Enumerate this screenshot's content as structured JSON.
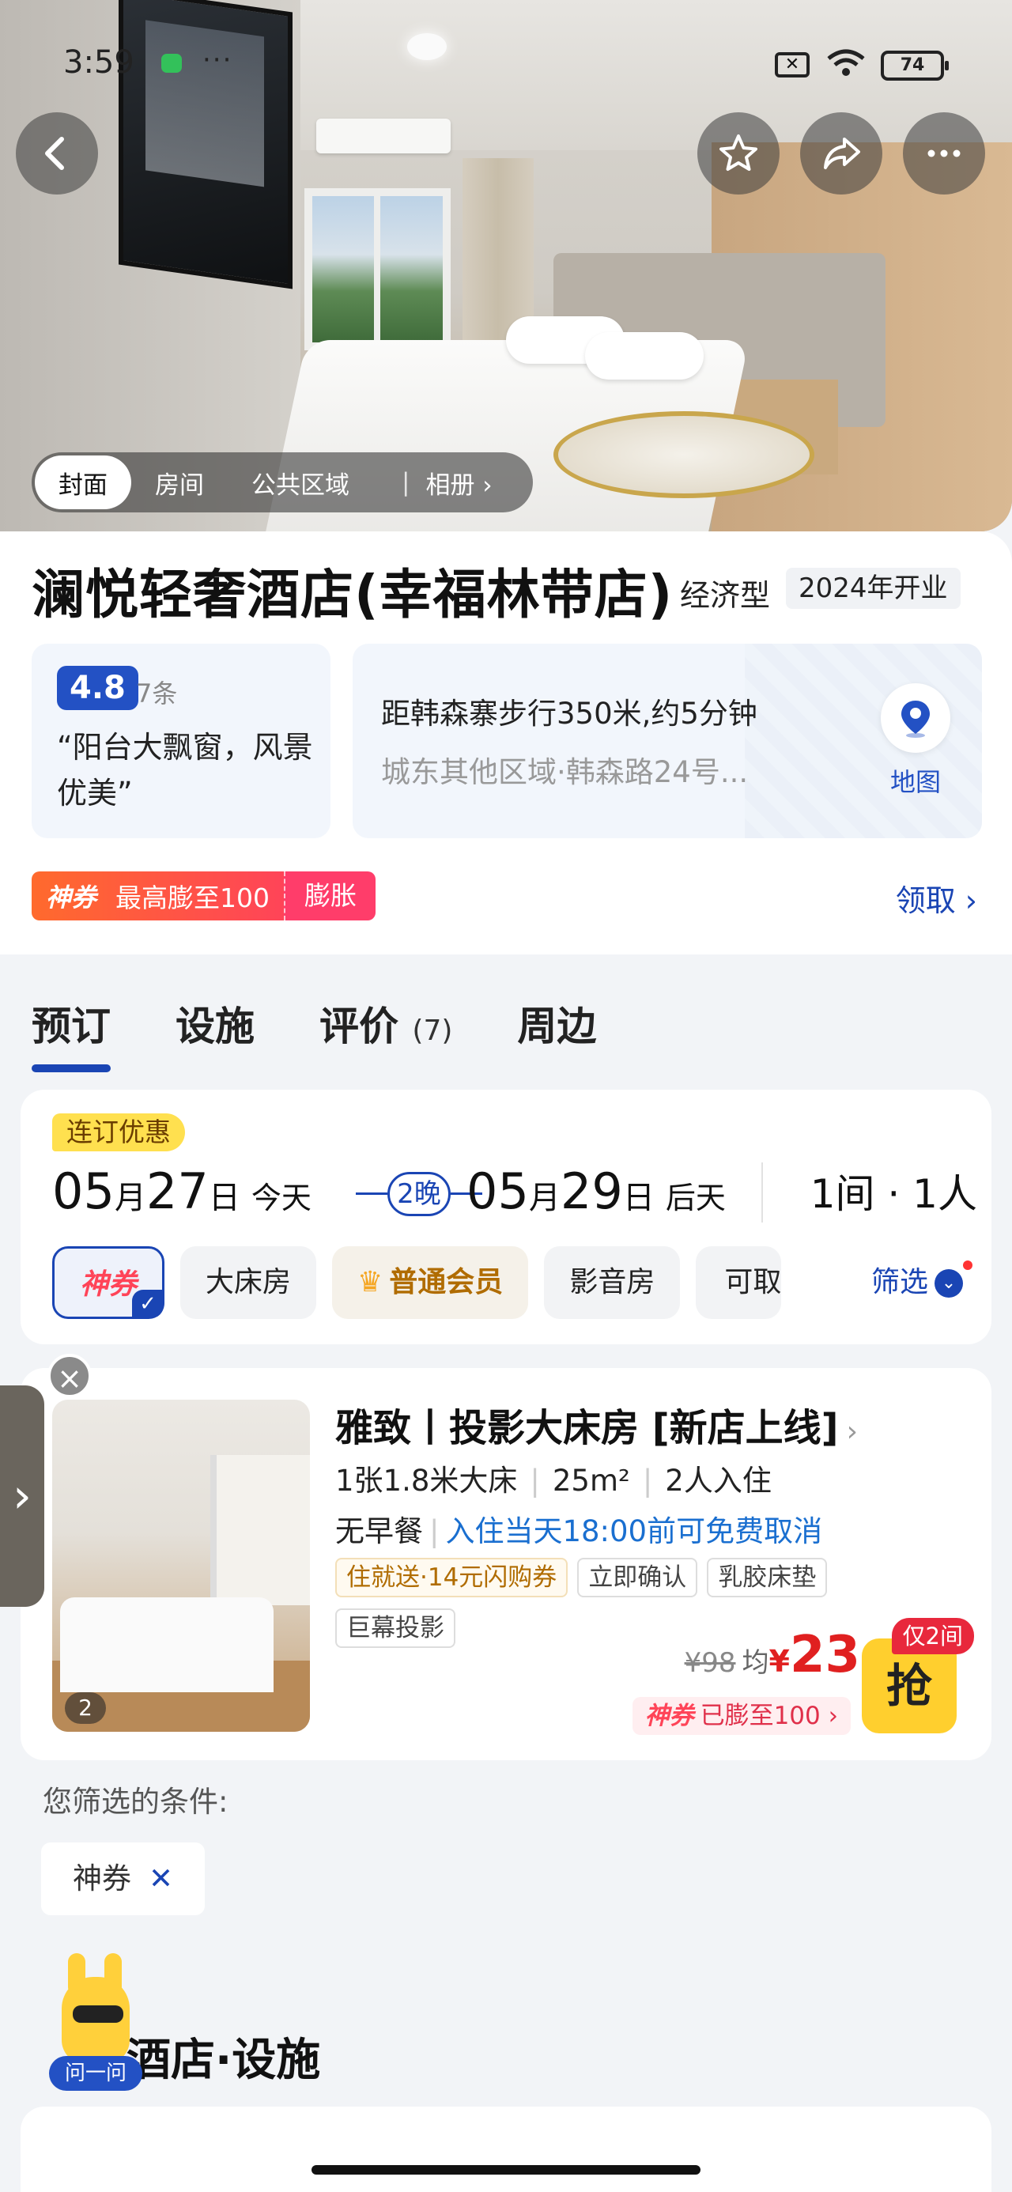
{
  "status_bar": {
    "time": "3:59",
    "more": "···",
    "battery": "74"
  },
  "hero": {
    "tabs": [
      "封面",
      "房间",
      "公共区域"
    ],
    "album_label": "相册 ›",
    "album_sep": "|"
  },
  "hotel": {
    "name": "澜悦轻奢酒店(幸福林带店)",
    "type": "经济型",
    "opened": "2024年开业",
    "rating": "4.8",
    "review_count": "7条",
    "review_quote": "“阳台大飘窗，风景优美”",
    "distance": "距韩森寨步行350米,约5分钟",
    "address": "城东其他区域·韩森路24号...",
    "map_label": "地图"
  },
  "coupon": {
    "brand": "神券",
    "text": "最高膨至100",
    "action": "膨胀",
    "claim": "领取 ›"
  },
  "section_tabs": [
    {
      "label": "预订",
      "count": ""
    },
    {
      "label": "设施",
      "count": ""
    },
    {
      "label": "评价",
      "count": "(7)"
    },
    {
      "label": "周边",
      "count": ""
    }
  ],
  "booking": {
    "promo": "连订优惠",
    "checkin": {
      "month": "05",
      "month_unit": "月",
      "day": "27",
      "day_unit": "日",
      "weekday": "今天"
    },
    "nights": "2晚",
    "checkout": {
      "month": "05",
      "month_unit": "月",
      "day": "29",
      "day_unit": "日",
      "weekday": "后天"
    },
    "rooms_people": "1间 · 1人",
    "filters": {
      "coupon_chip": "神券",
      "chip_big_bed": "大床房",
      "chip_member": "普通会员",
      "chip_av": "影音房",
      "chip_cut": "可取",
      "filter_btn": "筛选"
    }
  },
  "room": {
    "photo_count": "2",
    "name": "雅致丨投影大床房 [新店上线]",
    "bed": "1张1.8米大床",
    "area": "25m²",
    "occupancy": "2人入住",
    "breakfast": "无早餐",
    "cancel": "入住当天18:00前可免费取消",
    "tags": [
      "住就送·14元闪购券",
      "立即确认",
      "乳胶床垫",
      "巨幕投影"
    ],
    "original_price": "¥98",
    "avg_label": "均",
    "currency": "¥",
    "price": "23",
    "boosted_brand": "神券",
    "boosted_text": "已膨至100 ›",
    "grab": "抢",
    "only_left": "仅2间"
  },
  "conditions": {
    "title": "您筛选的条件:",
    "chip": "神券",
    "chip_remove": "✕"
  },
  "assistant_label": "问一问",
  "facilities_title": "酒店·设施",
  "colors": {
    "brand_blue": "#1a45b4",
    "price_red": "#e02020",
    "coupon_orange": "#ff6a2d",
    "grab_yellow": "#ffcf2e"
  }
}
